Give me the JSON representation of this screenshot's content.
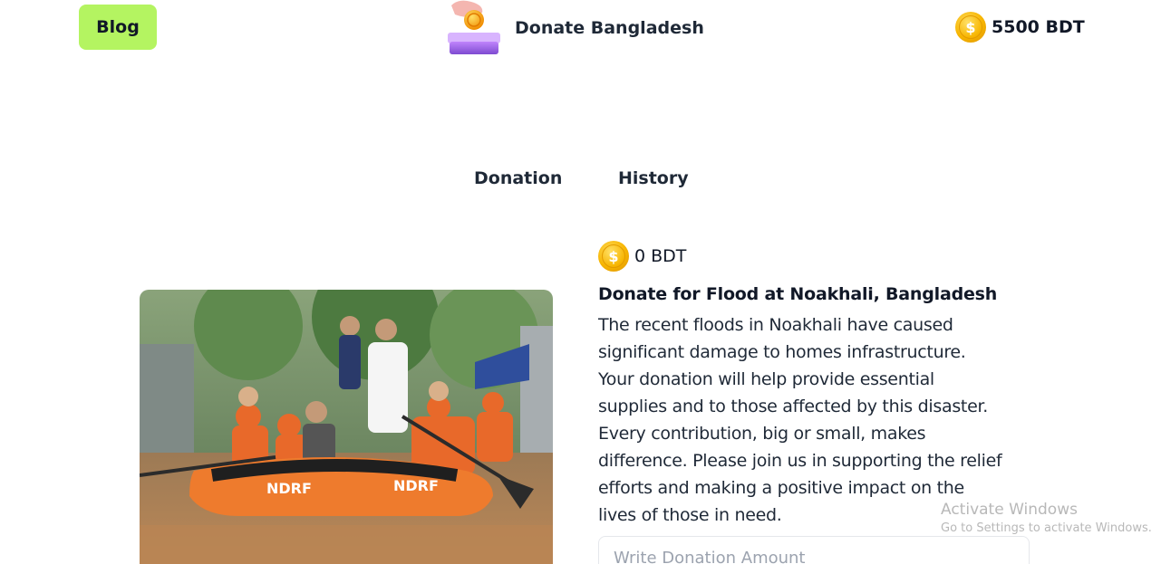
{
  "header": {
    "blog_label": "Blog",
    "brand_title": "Donate Bangladesh",
    "balance": "5500 BDT",
    "coin_symbol": "$"
  },
  "tabs": [
    {
      "label": "Donation",
      "active": true
    },
    {
      "label": "History",
      "active": false
    }
  ],
  "donation_card": {
    "raised": "0 BDT",
    "title": "Donate for Flood at Noakhali, Bangladesh",
    "description_lines": [
      "The recent floods in Noakhali have caused",
      "significant damage to homes infrastructure.",
      "Your donation will help provide essential",
      "supplies and to those affected by this disaster.",
      "Every contribution, big or small, makes",
      "difference. Please join us in supporting the relief",
      "efforts and making a positive impact on the",
      "lives of those in need."
    ],
    "input_placeholder": "Write Donation Amount"
  },
  "watermark": {
    "title": "Activate Windows",
    "subtitle": "Go to Settings to activate Windows."
  },
  "colors": {
    "accent": "#b4f461",
    "boat": "#f07a2a",
    "coin": "#f7b500"
  }
}
